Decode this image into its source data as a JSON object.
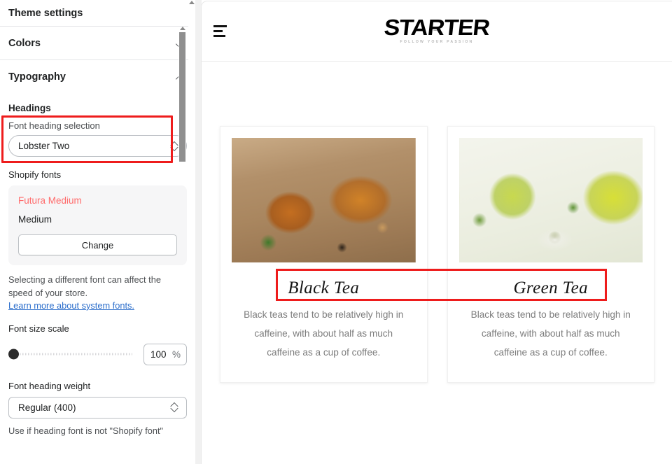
{
  "sidebar": {
    "panel_title": "Theme settings",
    "sections": {
      "colors": {
        "label": "Colors",
        "icon": "chevron-down-icon",
        "expanded": false
      },
      "typography": {
        "label": "Typography",
        "icon": "chevron-up-icon",
        "expanded": true
      }
    },
    "headings_subhead": "Headings",
    "font_heading_selection": {
      "label": "Font heading selection",
      "value": "Lobster Two",
      "icon": "up-down-chevron-icon"
    },
    "shopify_fonts": {
      "label": "Shopify fonts",
      "font_name": "Futura Medium",
      "font_name_color": "#ff6b6b",
      "font_weight": "Medium",
      "change_button": "Change"
    },
    "help": {
      "line1": "Selecting a different font can affect",
      "line2": "the speed of your store.",
      "link": "Learn more about system fonts."
    },
    "font_size_scale": {
      "label": "Font size scale",
      "value": "100",
      "unit": "%",
      "slider_position_percent": 0
    },
    "font_heading_weight": {
      "label": "Font heading weight",
      "value": "Regular (400)",
      "icon": "up-down-chevron-icon"
    },
    "bottom_note_line1": "Use if heading font is not \"Shopify",
    "bottom_note_line2": "font\""
  },
  "preview": {
    "menu_icon": "hamburger-menu-icon",
    "logo": {
      "word": "STARTER",
      "tagline": "FOLLOW YOUR PASSION"
    },
    "products": [
      {
        "title": "Black Tea",
        "description": "Black teas tend to be relatively high in caffeine, with about half as much caffeine as a cup of coffee.",
        "image_alt": "black-tea-cup-and-teapot"
      },
      {
        "title": "Green Tea",
        "description": "Black teas tend to be relatively high in caffeine, with about half as much caffeine as a cup of coffee.",
        "image_alt": "green-tea-glass-and-leaves"
      }
    ]
  },
  "annotations": {
    "color": "#ee1c1c",
    "boxes": [
      {
        "name": "font-heading-selection-highlight"
      },
      {
        "name": "product-titles-highlight"
      }
    ]
  }
}
